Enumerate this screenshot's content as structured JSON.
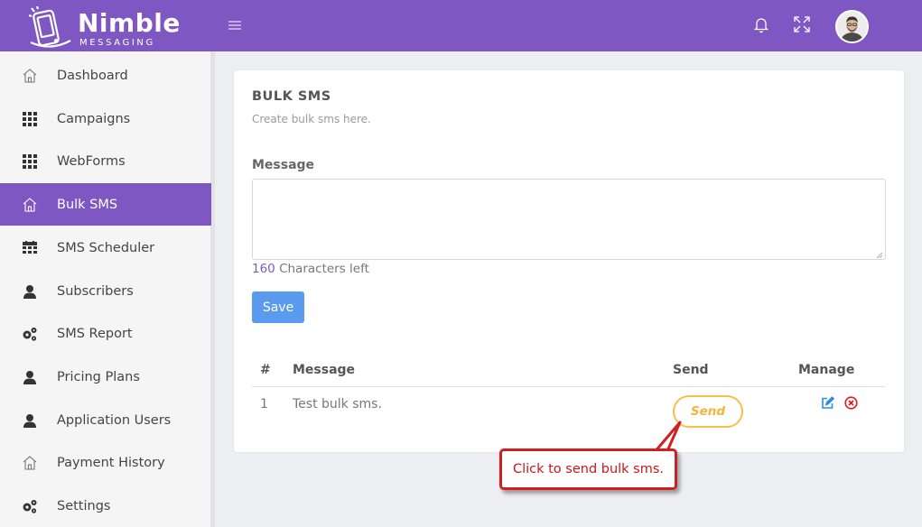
{
  "app": {
    "logo_title": "Nimble",
    "logo_subtitle": "MESSAGING"
  },
  "header": {
    "menu_icon": "hamburger-icon",
    "notification_icon": "bell-icon",
    "fullscreen_icon": "expand-icon",
    "avatar_icon": "user-avatar"
  },
  "sidebar": {
    "items": [
      {
        "label": "Dashboard",
        "icon": "home-icon",
        "active": false
      },
      {
        "label": "Campaigns",
        "icon": "grid-icon",
        "active": false
      },
      {
        "label": "WebForms",
        "icon": "grid-icon",
        "active": false
      },
      {
        "label": "Bulk SMS",
        "icon": "home-icon",
        "active": true
      },
      {
        "label": "SMS Scheduler",
        "icon": "calendar-icon",
        "active": false
      },
      {
        "label": "Subscribers",
        "icon": "user-icon",
        "active": false
      },
      {
        "label": "SMS Report",
        "icon": "gears-icon",
        "active": false
      },
      {
        "label": "Pricing Plans",
        "icon": "user-icon",
        "active": false
      },
      {
        "label": "Application Users",
        "icon": "user-icon",
        "active": false
      },
      {
        "label": "Payment History",
        "icon": "home-icon",
        "active": false
      },
      {
        "label": "Settings",
        "icon": "gears-icon",
        "active": false
      }
    ]
  },
  "main": {
    "title": "BULK SMS",
    "subtitle": "Create bulk sms here.",
    "message_label": "Message",
    "message_value": "",
    "chars_left_count": "160",
    "chars_left_text": "Characters left",
    "save_label": "Save",
    "table": {
      "headers": [
        "#",
        "Message",
        "Send",
        "Manage"
      ],
      "rows": [
        {
          "num": "1",
          "message": "Test bulk sms.",
          "send_label": "Send"
        }
      ]
    }
  },
  "callout": {
    "text": "Click to send bulk sms."
  },
  "colors": {
    "brand": "#7e57c2",
    "save_button": "#5b9bef",
    "send_button": "#f7c04a",
    "callout": "#d11f1f"
  }
}
